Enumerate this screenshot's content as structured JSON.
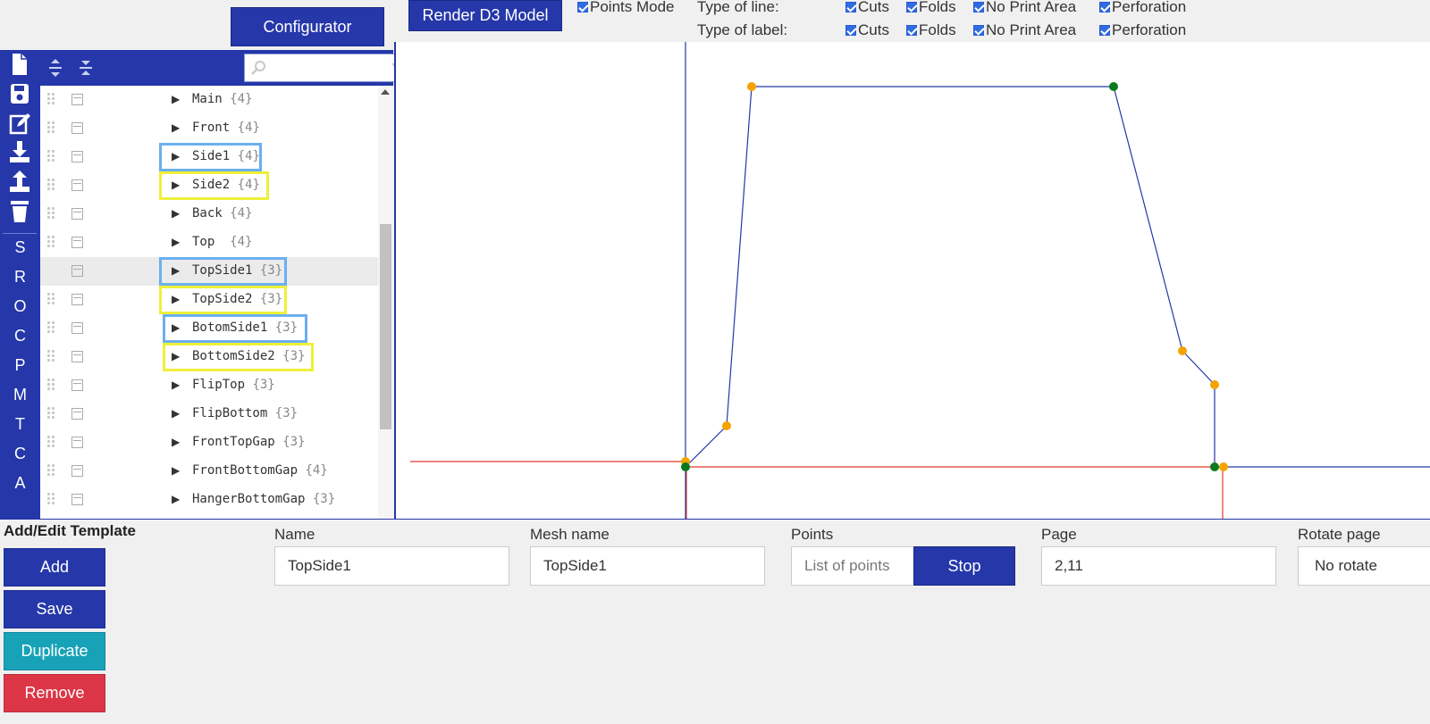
{
  "toolbar": {
    "configurator_label": "Configurator",
    "render_label": "Render D3 Model",
    "points_mode_label": "Points Mode",
    "type_of_line_label": "Type of line:",
    "type_of_label_label": "Type of label:",
    "line_options": [
      "Cuts",
      "Folds",
      "No Print Area",
      "Perforation"
    ],
    "label_options": [
      "Cuts",
      "Folds",
      "No Print Area",
      "Perforation"
    ]
  },
  "rail": {
    "icons": [
      "new-file-icon",
      "save-icon",
      "edit-icon",
      "download-icon",
      "upload-icon",
      "trash-icon"
    ],
    "letters": [
      "S",
      "R",
      "O",
      "C",
      "P",
      "M",
      "T",
      "C",
      "A"
    ]
  },
  "tree": {
    "toolbar_icons": [
      "expand-all-icon",
      "collapse-all-icon"
    ],
    "search_icons": [
      "search-icon",
      "sort-down-icon",
      "sort-up-icon"
    ],
    "items": [
      {
        "label": "Main",
        "count": "{4}"
      },
      {
        "label": "Front",
        "count": "{4}"
      },
      {
        "label": "Side1",
        "count": "{4}"
      },
      {
        "label": "Side2",
        "count": "{4}"
      },
      {
        "label": "Back",
        "count": "{4}"
      },
      {
        "label": "Top ",
        "count": "{4}"
      },
      {
        "label": "TopSide1",
        "count": "{3}"
      },
      {
        "label": "TopSide2",
        "count": "{3}"
      },
      {
        "label": "BotomSide1",
        "count": "{3}"
      },
      {
        "label": "BottomSide2",
        "count": "{3}"
      },
      {
        "label": "FlipTop",
        "count": "{3}"
      },
      {
        "label": "FlipBottom",
        "count": "{3}"
      },
      {
        "label": "FrontTopGap",
        "count": "{3}"
      },
      {
        "label": "FrontBottomGap",
        "count": "{4}"
      },
      {
        "label": "HangerBottomGap",
        "count": "{3}"
      }
    ],
    "selected_index": 6
  },
  "form": {
    "title": "Add/Edit Template",
    "add_label": "Add",
    "save_label": "Save",
    "duplicate_label": "Duplicate",
    "remove_label": "Remove",
    "name_label": "Name",
    "name_value": "TopSide1",
    "mesh_label": "Mesh name",
    "mesh_value": "TopSide1",
    "points_label": "Points",
    "points_placeholder": "List of points",
    "stop_label": "Stop",
    "page_label": "Page",
    "page_value": "2,11",
    "rotate_label": "Rotate page",
    "rotate_value": "No rotate"
  },
  "colors": {
    "primary": "#2537a9",
    "duplicate": "#17a2b8",
    "remove": "#dc3545",
    "highlight_blue": "#6ab0ef",
    "highlight_yellow": "#eef03a",
    "point_orange": "#f5a300",
    "point_green": "#0b7a1e",
    "axis_red": "#e03a2a"
  }
}
